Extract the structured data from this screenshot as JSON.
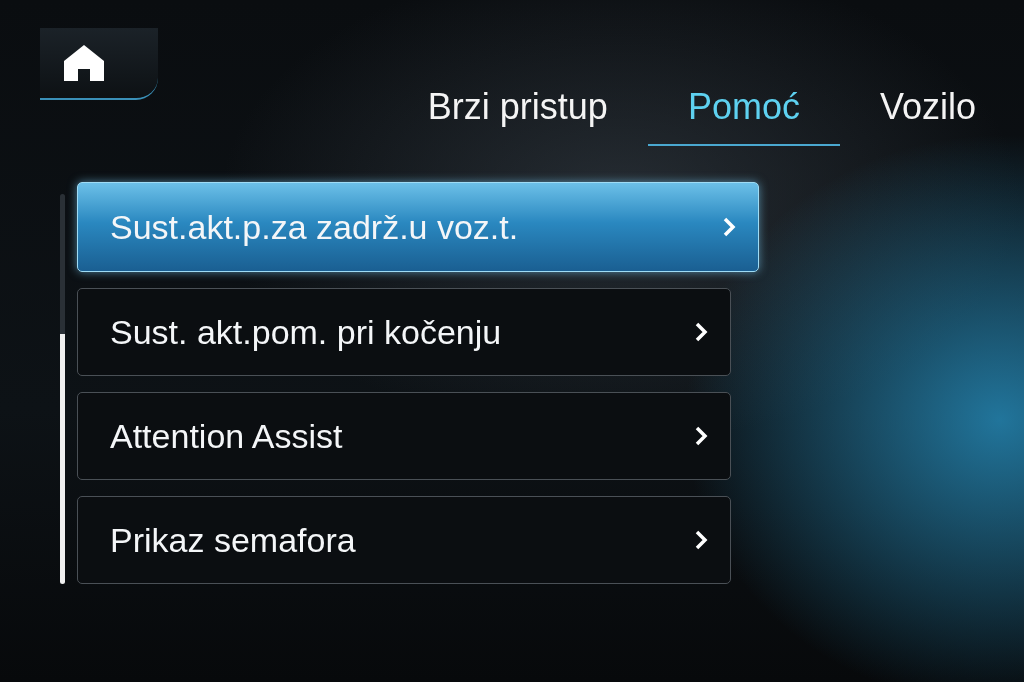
{
  "tabs": [
    {
      "label": "Brzi pristup",
      "selected": false
    },
    {
      "label": "Pomoć",
      "selected": true
    },
    {
      "label": "Vozilo",
      "selected": false
    }
  ],
  "menu": {
    "items": [
      {
        "label": "Sust.akt.p.za zadrž.u voz.t.",
        "selected": true
      },
      {
        "label": "Sust. akt.pom. pri kočenju",
        "selected": false
      },
      {
        "label": "Attention Assist",
        "selected": false
      },
      {
        "label": "Prikaz semafora",
        "selected": false
      }
    ]
  }
}
